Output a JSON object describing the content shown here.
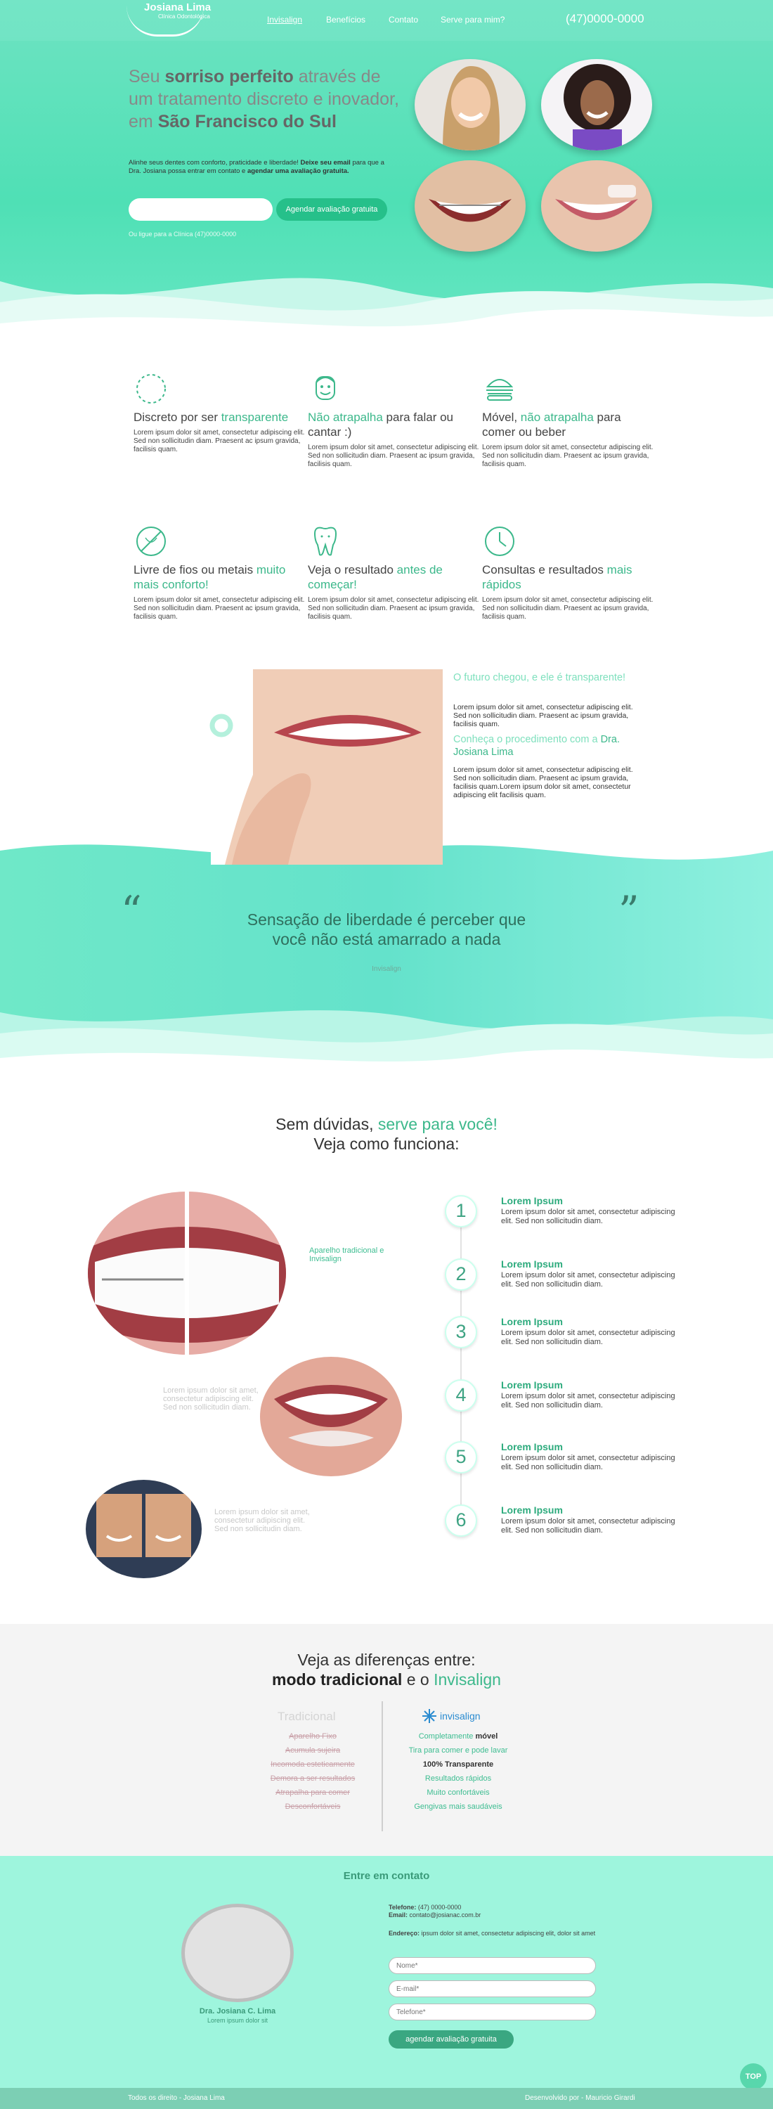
{
  "header": {
    "logo_title": "Josiana Lima",
    "logo_subtitle": "Clínica Odontológica",
    "nav": [
      "Invisalign",
      "Benefícios",
      "Contato",
      "Serve para mim?"
    ],
    "phone": "(47)0000-0000"
  },
  "hero": {
    "h_1": "Seu ",
    "h_2": "sorriso perfeito",
    "h_3": " através de um tratamento discreto e inovador, em ",
    "h_4": "São Francisco do Sul",
    "p_1": "Alinhe seus dentes com conforto, praticidade e liberdade! ",
    "p_2": "Deixe seu email",
    "p_3": " para que a Dra. Josiana possa entrar em contato e ",
    "p_4": "agendar uma avaliação gratuita.",
    "input_placeholder": "",
    "cta": "Agendar avaliação gratuita",
    "call_text": "Ou ligue para a Clínica (47)0000-0000"
  },
  "features": [
    {
      "t1": "Discreto por ser ",
      "t2": "transparente",
      "t3": "",
      "icon": "dashed-circle-icon"
    },
    {
      "t1": "",
      "t2": "Não atrapalha",
      "t3": " para falar ou cantar :)",
      "icon": "smiling-face-icon"
    },
    {
      "t1": "Móvel, ",
      "t2": "não atrapalha",
      "t3": " para comer ou beber",
      "icon": "burger-icon"
    },
    {
      "t1": "Livre de fios ou metais ",
      "t2": "muito mais conforto!",
      "t3": "",
      "icon": "no-wire-icon"
    },
    {
      "t1": "Veja o resultado ",
      "t2": "antes de começar!",
      "t3": "",
      "icon": "tooth-icon"
    },
    {
      "t1": "Consultas e resultados ",
      "t2": "mais rápidos",
      "t3": "",
      "icon": "clock-icon"
    }
  ],
  "feature_text": "Lorem ipsum dolor sit amet, consectetur adipiscing elit. Sed non sollicitudin diam. Praesent ac ipsum gravida, facilisis quam.",
  "future": {
    "h1": "O futuro chegou, e ele é transparente!",
    "p1": "Lorem ipsum dolor sit amet, consectetur adipiscing elit. Sed non sollicitudin diam. Praesent ac ipsum gravida, facilisis quam.",
    "h2_1": "Conheça o procedimento com a ",
    "h2_2": "Dra. Josiana Lima",
    "p2": "Lorem ipsum dolor sit amet, consectetur adipiscing elit. Sed non sollicitudin diam. Praesent ac ipsum gravida, facilisis quam.Lorem ipsum dolor sit amet, consectetur adipiscing elit facilisis quam."
  },
  "quote": {
    "text": "Sensação de liberdade é perceber que você não está amarrado a nada",
    "source": "Invisalign",
    "open": "“",
    "close": "”"
  },
  "steps_section": {
    "h_1": "Sem dúvidas, ",
    "h_2": "serve para você!",
    "h_3": "Veja como funciona:",
    "caption_1": "Aparelho tradicional e Invisalign",
    "caption_2": "Lorem ipsum dolor sit amet, consectetur adipiscing elit. Sed non sollicitudin diam.",
    "caption_3": "Lorem ipsum dolor sit amet, consectetur adipiscing elit. Sed non sollicitudin diam.",
    "steps": [
      {
        "num": "1",
        "title": "Lorem Ipsum",
        "text": "Lorem ipsum dolor sit amet, consectetur adipiscing elit. Sed non sollicitudin diam."
      },
      {
        "num": "2",
        "title": "Lorem Ipsum",
        "text": "Lorem ipsum dolor sit amet, consectetur adipiscing elit. Sed non sollicitudin diam."
      },
      {
        "num": "3",
        "title": "Lorem Ipsum",
        "text": "Lorem ipsum dolor sit amet, consectetur adipiscing elit. Sed non sollicitudin diam."
      },
      {
        "num": "4",
        "title": "Lorem Ipsum",
        "text": "Lorem ipsum dolor sit amet, consectetur adipiscing elit. Sed non sollicitudin diam."
      },
      {
        "num": "5",
        "title": "Lorem Ipsum",
        "text": "Lorem ipsum dolor sit amet, consectetur adipiscing elit. Sed non sollicitudin diam."
      },
      {
        "num": "6",
        "title": "Lorem Ipsum",
        "text": "Lorem ipsum dolor sit amet, consectetur adipiscing elit. Sed non sollicitudin diam."
      }
    ]
  },
  "diff": {
    "h_1": "Veja as diferenças entre:",
    "h_2": "modo tradicional",
    "h_3": " e o ",
    "h_4": "Invisalign",
    "trad_title": "Tradicional",
    "inv_logo": "invisalign",
    "trad_items": [
      "Aparelho Fixo",
      "Acumula sujeira",
      "Incomoda esteticamente",
      "Demora a ser resultados",
      "Atrapalha para comer",
      "Desconfortáveis"
    ],
    "inv_items": [
      {
        "a": "Completamente ",
        "b": "móvel"
      },
      {
        "a": "Tira para comer e pode lavar",
        "b": ""
      },
      {
        "a": "",
        "b": "100% Transparente"
      },
      {
        "a": "Resultados rápidos",
        "b": ""
      },
      {
        "a": "Muito confortáveis",
        "b": ""
      },
      {
        "a": "Gengivas mais saudáveis",
        "b": ""
      }
    ]
  },
  "contact": {
    "title": "Entre em contato",
    "phone_label": "Telefone:",
    "phone": " (47) 0000-0000",
    "email_label": "Email:",
    "email": " contato@josianac.com.br",
    "address_label": "Endereço:",
    "address": " ipsum dolor sit amet, consectetur adipiscing elit, dolor sit amet",
    "name_ph": "Nome*",
    "email_ph": "E-mail*",
    "tel_ph": "Telefone*",
    "submit": "agendar avaliação gratuita",
    "doctor": "Dra. Josiana C. Lima",
    "doctor_sub": "Lorem ipsum dolor sit"
  },
  "footer": {
    "left": "Todos os direito - Josiana Lima",
    "right": "Desenvolvido por - Mauricio Girardi",
    "top": "TOP"
  },
  "colors": {
    "accent": "#3cb88b",
    "mint": "#4fe0b5",
    "button": "#26c08a"
  }
}
